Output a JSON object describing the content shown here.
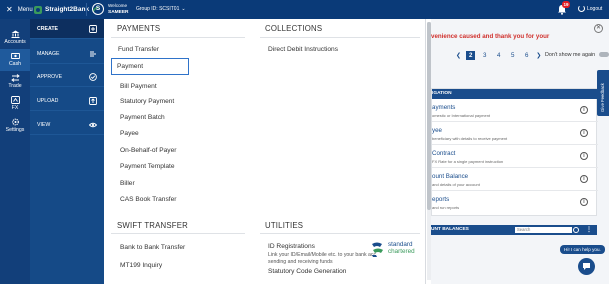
{
  "topbar": {
    "menu_label": "Menu",
    "brand": "Straight2Bank",
    "avatar_initial": "S",
    "welcome_label": "Welcome",
    "welcome_user": "SAMEER",
    "group_label": "Group ID: SCSIT01",
    "notification_count": "19",
    "logout_label": "Logout"
  },
  "rail": {
    "items": [
      {
        "label": "Accounts",
        "icon": "accounts-icon"
      },
      {
        "label": "Cash",
        "icon": "cash-icon",
        "active": true
      },
      {
        "label": "Trade",
        "icon": "trade-icon"
      },
      {
        "label": "FX",
        "icon": "fx-icon"
      },
      {
        "label": "Settings",
        "icon": "settings-icon"
      }
    ]
  },
  "submenu": {
    "items": [
      {
        "label": "CREATE",
        "icon": "create-icon",
        "active": true
      },
      {
        "label": "MANAGE",
        "icon": "manage-icon"
      },
      {
        "label": "APPROVE",
        "icon": "approve-icon"
      },
      {
        "label": "UPLOAD",
        "icon": "upload-icon"
      },
      {
        "label": "VIEW",
        "icon": "view-icon"
      }
    ]
  },
  "mega": {
    "payments_title": "PAYMENTS",
    "payments": [
      "Fund Transfer",
      "Payment",
      "Bill Payment",
      "Statutory Payment",
      "Payment Batch",
      "Payee",
      "On-Behalf-of Payer",
      "Payment Template",
      "Biller",
      "CAS Book Transfer"
    ],
    "collections_title": "COLLECTIONS",
    "collections": [
      "Direct Debit Instructions"
    ],
    "swift_title": "SWIFT TRANSFER",
    "swift": [
      "Bank to Bank Transfer",
      "MT199 Inquiry"
    ],
    "utilities_title": "UTILITIES",
    "utilities": {
      "id_reg_title": "ID Registrations",
      "id_reg_desc": "Link your ID/Email/Mobile etc. to your bank acc sending and receiving funds",
      "statutory": "Statutory Code Generation"
    },
    "selected": "Payment",
    "brand_logo_line1": "standard",
    "brand_logo_line2": "chartered"
  },
  "dashboard": {
    "apology": "venience caused and thank you for your",
    "pages": [
      "2",
      "3",
      "4",
      "5",
      "6"
    ],
    "current_page": "2",
    "dont_show": "Don't show me again",
    "nav_header": "IGATION",
    "nav_items": [
      {
        "title": "ayments",
        "desc": "omestic or International payment"
      },
      {
        "title": "yee",
        "desc": "beneficiary with details to receive payment"
      },
      {
        "title": "Contract",
        "desc": "FX Rate for a single payment instruction"
      },
      {
        "title": "ount Balance",
        "desc": "and details of your account"
      },
      {
        "title": "eports",
        "desc": "and run reports"
      }
    ],
    "accounts_header": "UNT BALANCES",
    "search_placeholder": "Search",
    "feedback_label": "Give Feedback",
    "chat_bubble": "Hi! I can help you.",
    "colors": {
      "primary": "#1a4d8c",
      "topbar": "#0a3a78",
      "alert": "#d0312d",
      "accent": "#2f73c9"
    }
  }
}
